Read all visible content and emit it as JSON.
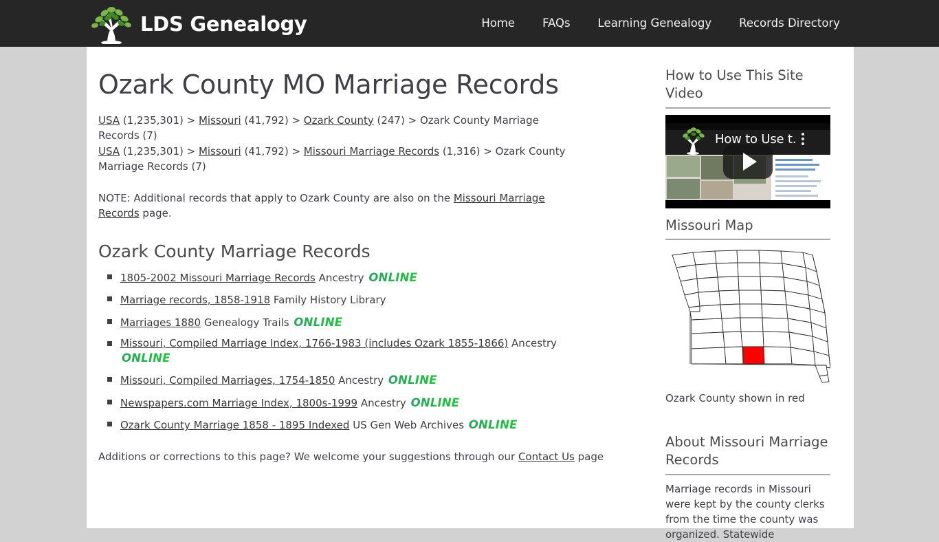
{
  "site": {
    "brand_name": "LDS Genealogy",
    "nav": [
      {
        "label": "Home"
      },
      {
        "label": "FAQs"
      },
      {
        "label": "Learning Genealogy"
      },
      {
        "label": "Records Directory"
      }
    ]
  },
  "main": {
    "title": "Ozark County MO Marriage Records",
    "breadcrumb_1": {
      "usa": "USA",
      "usa_count": " (1,235,301) > ",
      "state": "Missouri",
      "state_count": " (41,792) > ",
      "county": "Ozark County",
      "county_count": " (247) > ",
      "current": "Ozark County Marriage Records (7)"
    },
    "breadcrumb_2": {
      "usa": "USA",
      "usa_count": " (1,235,301) > ",
      "state": "Missouri",
      "state_count": " (41,792) > ",
      "state_records": "Missouri Marriage Records",
      "state_records_count": " (1,316) > ",
      "current": "Ozark County Marriage Records (7)"
    },
    "note_before": "NOTE: Additional records that apply to Ozark County are also on the ",
    "note_link": "Missouri Marriage Records",
    "note_after": " page.",
    "section_heading": "Ozark County Marriage Records",
    "records": [
      {
        "link": "1805-2002 Missouri Marriage Records",
        "source": "Ancestry",
        "badge": "ONLINE"
      },
      {
        "link": "Marriage records, 1858-1918",
        "source": "Family History Library",
        "badge": ""
      },
      {
        "link": "Marriages 1880",
        "source": "Genealogy Trails",
        "badge": "ONLINE"
      },
      {
        "link": "Missouri, Compiled Marriage Index, 1766-1983 (includes Ozark 1855-1866)",
        "source": "Ancestry",
        "badge": "ONLINE"
      },
      {
        "link": "Missouri, Compiled Marriages, 1754-1850",
        "source": "Ancestry",
        "badge": "ONLINE"
      },
      {
        "link": "Newspapers.com Marriage Index, 1800s-1999",
        "source": "Ancestry",
        "badge": "ONLINE"
      },
      {
        "link": "Ozark County Marriage 1858 - 1895 Indexed",
        "source": "US Gen Web Archives",
        "badge": "ONLINE"
      }
    ],
    "footnote_before": "Additions or corrections to this page? We welcome your suggestions through our ",
    "footnote_link": "Contact Us",
    "footnote_after": " page"
  },
  "sidebar": {
    "video_heading": "How to Use This Site Video",
    "video_overlay_title": "How to Use t...",
    "map_heading": "Missouri Map",
    "map_caption": "Ozark County shown in red",
    "about_heading": "About Missouri Marriage Records",
    "about_text": "Marriage records in Missouri were kept by the county clerks from the time the county was organized. Statewide"
  },
  "colors": {
    "header_bg": "#262626",
    "page_bg": "#d2d2d2",
    "content_bg": "#ffffff",
    "text": "#3f3f46",
    "online_badge": "#2fb457",
    "highlight_county": "#ff0000",
    "rule": "#a8a8a8"
  }
}
